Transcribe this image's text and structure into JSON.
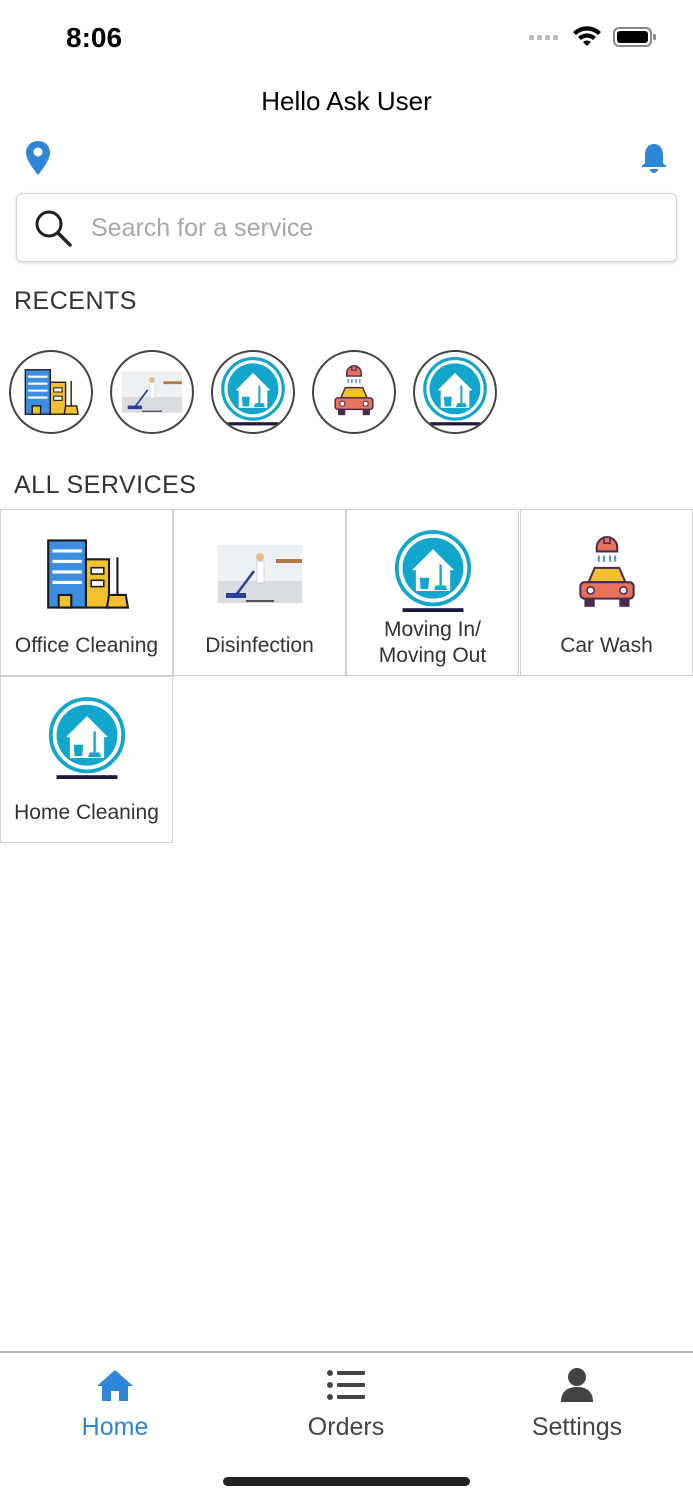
{
  "status_bar": {
    "time": "8:06"
  },
  "header": {
    "greeting": "Hello Ask User"
  },
  "search": {
    "placeholder": "Search for a service"
  },
  "recents": {
    "title": "RECENTS",
    "items": [
      {
        "icon": "office-building-icon"
      },
      {
        "icon": "disinfection-photo"
      },
      {
        "icon": "house-cleaning-icon"
      },
      {
        "icon": "car-wash-icon"
      },
      {
        "icon": "house-cleaning-icon"
      }
    ]
  },
  "services": {
    "title": "ALL SERVICES",
    "items": [
      {
        "label": "Office Cleaning",
        "icon": "office-building-icon"
      },
      {
        "label": "Disinfection",
        "icon": "disinfection-photo"
      },
      {
        "label": "Moving In/ Moving Out",
        "icon": "house-cleaning-icon"
      },
      {
        "label": "Car Wash",
        "icon": "car-wash-icon"
      },
      {
        "label": "Home Cleaning",
        "icon": "house-cleaning-icon"
      }
    ]
  },
  "tabs": [
    {
      "label": "Home",
      "icon": "home-icon",
      "active": true
    },
    {
      "label": "Orders",
      "icon": "list-icon",
      "active": false
    },
    {
      "label": "Settings",
      "icon": "user-icon",
      "active": false
    }
  ],
  "colors": {
    "accent": "#2f86d6",
    "teal": "#13a6cc",
    "gold": "#f2c12e"
  }
}
